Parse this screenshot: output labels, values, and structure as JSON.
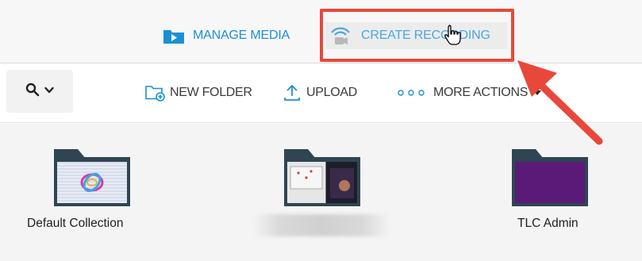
{
  "nav": {
    "manage_media": "MANAGE MEDIA",
    "create_recording": "CREATE RECORDING"
  },
  "toolbar": {
    "new_folder": "NEW FOLDER",
    "upload": "UPLOAD",
    "more_actions": "MORE ACTIONS"
  },
  "folders": [
    {
      "label": "Default Collection"
    },
    {
      "label": ""
    },
    {
      "label": "TLC Admin"
    }
  ],
  "colors": {
    "accent": "#1b8fd6",
    "highlight": "#e8483a",
    "folder": "#2f4553",
    "purple_thumb": "#5b1a78"
  }
}
